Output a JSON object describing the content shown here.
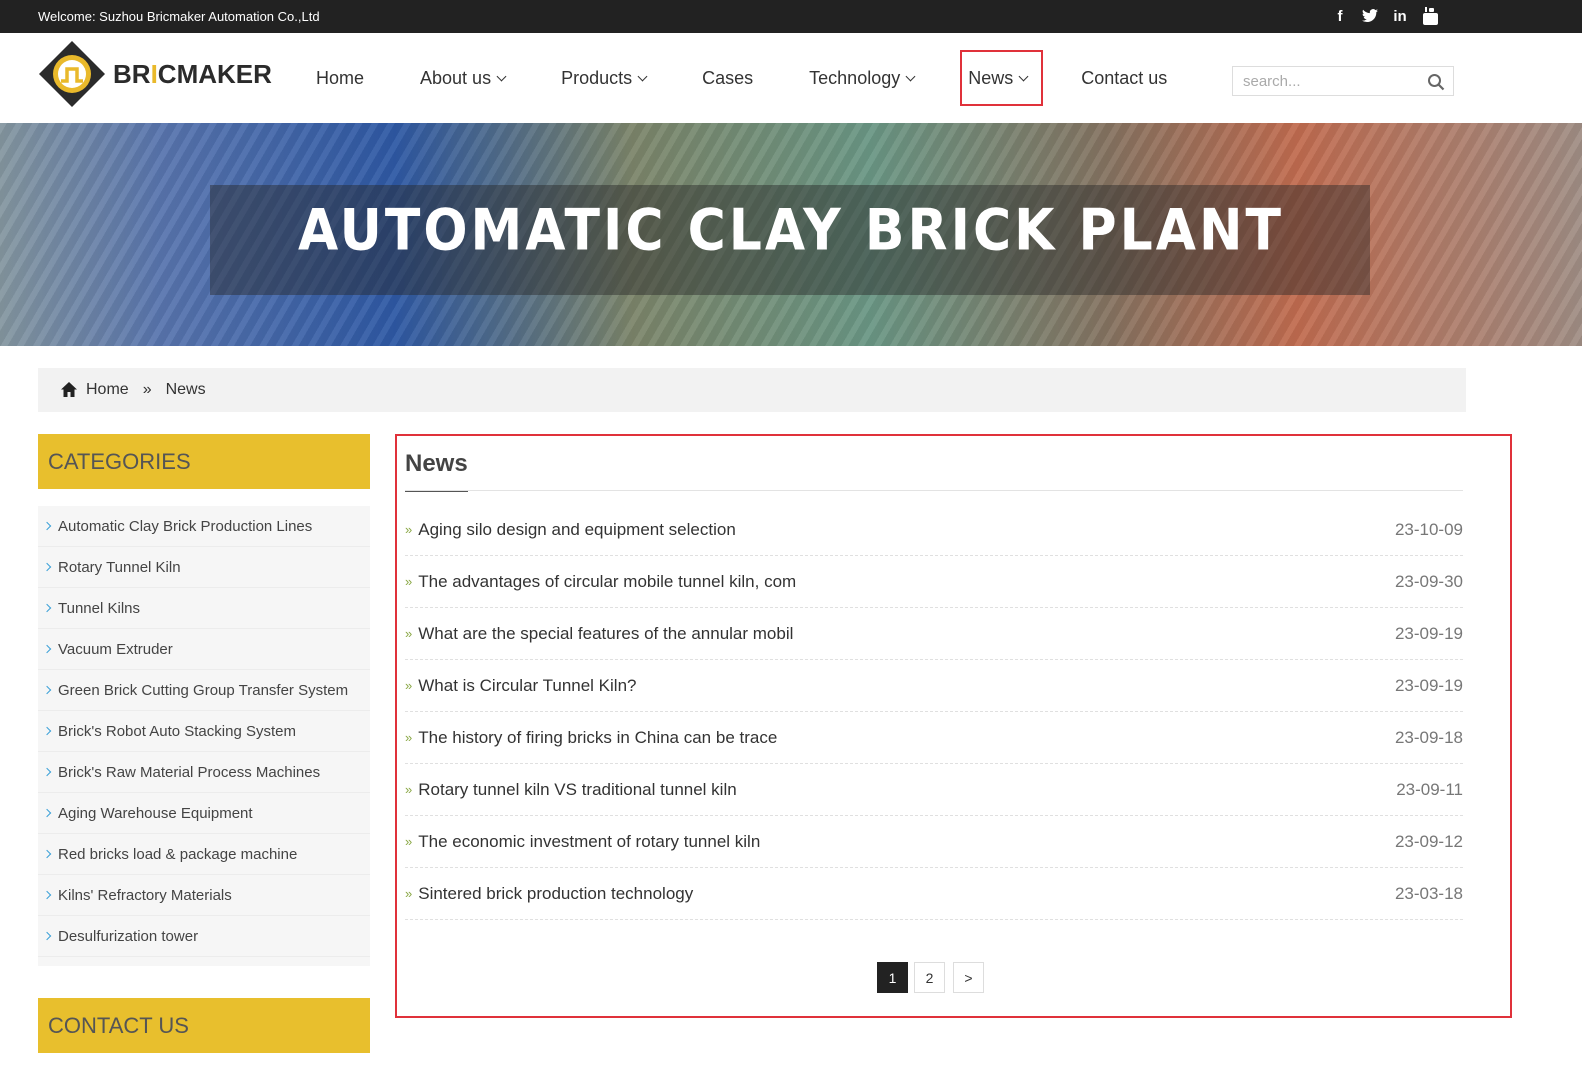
{
  "topbar": {
    "welcome": "Welcome: Suzhou Bricmaker Automation Co.,Ltd",
    "social": [
      "facebook-icon",
      "twitter-icon",
      "linkedin-icon",
      "youtube-icon"
    ]
  },
  "logo": {
    "pre": "BR",
    "i": "I",
    "post": "CMAKER"
  },
  "nav": {
    "items": [
      {
        "label": "Home",
        "dropdown": false
      },
      {
        "label": "About us",
        "dropdown": true
      },
      {
        "label": "Products",
        "dropdown": true
      },
      {
        "label": "Cases",
        "dropdown": false
      },
      {
        "label": "Technology",
        "dropdown": true
      },
      {
        "label": "News",
        "dropdown": true,
        "active": true
      },
      {
        "label": "Contact us",
        "dropdown": false
      }
    ]
  },
  "search": {
    "placeholder": "search..."
  },
  "banner": {
    "title": "AUTOMATIC CLAY BRICK PLANT"
  },
  "breadcrumb": {
    "home": "Home",
    "sep": "»",
    "current": "News"
  },
  "sidebar": {
    "categories_title": "CATEGORIES",
    "categories": [
      "Automatic Clay Brick Production Lines",
      "Rotary Tunnel Kiln",
      "Tunnel Kilns",
      "Vacuum Extruder",
      "Green Brick Cutting Group Transfer System",
      "Brick's Robot Auto Stacking System",
      "Brick's Raw Material Process Machines",
      "Aging Warehouse Equipment",
      "Red bricks load & package machine",
      "Kilns' Refractory Materials",
      "Desulfurization tower"
    ],
    "contact_title": "CONTACT US"
  },
  "news": {
    "title": "News",
    "bullet": "»",
    "items": [
      {
        "title": "Aging silo design and equipment selection",
        "date": "23-10-09"
      },
      {
        "title": "The advantages of circular mobile tunnel kiln, com",
        "date": "23-09-30"
      },
      {
        "title": "What are the special features of the annular mobil",
        "date": "23-09-19"
      },
      {
        "title": "What is Circular Tunnel Kiln?",
        "date": "23-09-19"
      },
      {
        "title": "The history of firing bricks in China can be trace",
        "date": "23-09-18"
      },
      {
        "title": "Rotary tunnel kiln VS traditional tunnel kiln",
        "date": "23-09-11"
      },
      {
        "title": "The economic investment of rotary tunnel kiln",
        "date": "23-09-12"
      },
      {
        "title": "Sintered brick production technology",
        "date": "23-03-18"
      }
    ],
    "pager": {
      "pages": [
        "1",
        "2"
      ],
      "current": "1",
      "next": ">"
    }
  },
  "colors": {
    "accent": "#e8bf2d",
    "highlight": "#e0313a",
    "topbar": "#222222"
  }
}
